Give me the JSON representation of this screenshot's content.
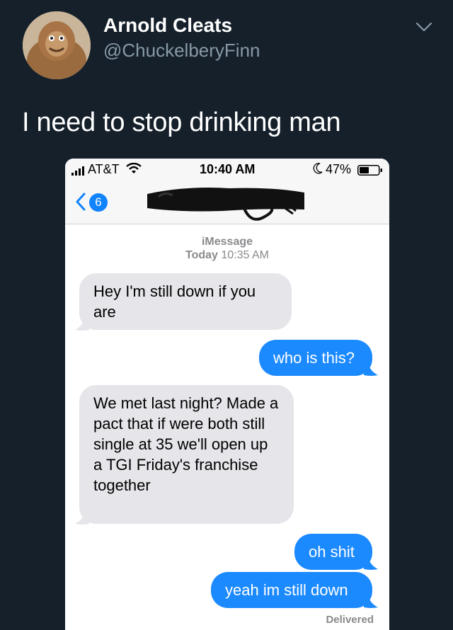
{
  "tweet": {
    "author_name": "Arnold Cleats",
    "author_handle": "@ChuckelberyFinn",
    "text": "I need to stop drinking man",
    "menu_icon": "chevron-down-icon"
  },
  "phone": {
    "status_bar": {
      "carrier": "AT&T",
      "time": "10:40 AM",
      "battery": "47%"
    },
    "nav": {
      "back_badge": "6"
    },
    "conversation": {
      "service": "iMessage",
      "timestamp_day": "Today",
      "timestamp_time": "10:35 AM",
      "messages": [
        {
          "direction": "incoming",
          "text": "Hey I'm still down if you are"
        },
        {
          "direction": "outgoing",
          "text": "who is this?"
        },
        {
          "direction": "incoming",
          "text": "We met last night? Made a pact that if were both still single at 35 we'll open up a TGI Friday's franchise together"
        },
        {
          "direction": "outgoing",
          "text": "oh shit"
        },
        {
          "direction": "outgoing",
          "text": "yeah im still down"
        }
      ],
      "delivery_status": "Delivered"
    },
    "colors": {
      "incoming_bubble": "#e5e5ea",
      "outgoing_bubble": "#1c8aff",
      "badge": "#1183fd"
    }
  },
  "colors": {
    "background": "#15202b",
    "secondary_text": "#8899a6"
  }
}
